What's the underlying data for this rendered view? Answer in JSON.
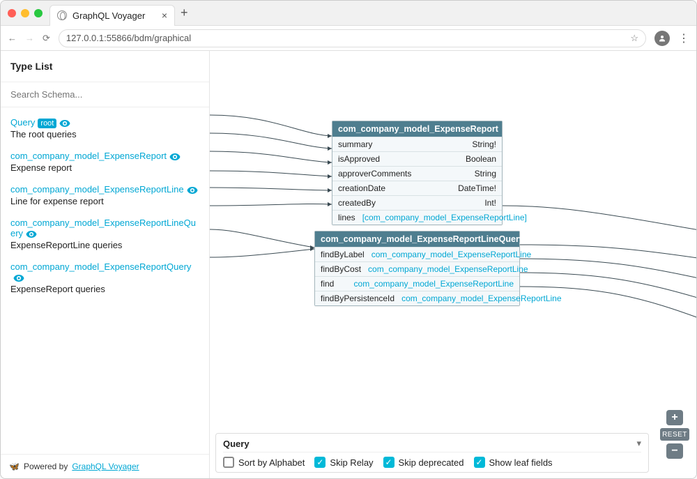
{
  "browser": {
    "tab_title": "GraphQL Voyager",
    "url": "127.0.0.1:55866/bdm/graphical"
  },
  "sidebar": {
    "title": "Type List",
    "search_placeholder": "Search Schema...",
    "items": [
      {
        "name": "Query",
        "root_badge": "root",
        "desc": "The root queries"
      },
      {
        "name": "com_company_model_ExpenseReport",
        "desc": "Expense report"
      },
      {
        "name": "com_company_model_ExpenseReportLine",
        "desc": "Line for expense report"
      },
      {
        "name": "com_company_model_ExpenseReportLineQuery",
        "desc": "ExpenseReportLine queries"
      },
      {
        "name": "com_company_model_ExpenseReportQuery",
        "desc": "ExpenseReport queries"
      }
    ],
    "footer_prefix": "Powered by ",
    "footer_link": "GraphQL Voyager"
  },
  "canvas": {
    "cards": [
      {
        "title": "com_company_model_ExpenseReport",
        "fields": [
          {
            "k": "summary",
            "v": "String!",
            "link": false
          },
          {
            "k": "isApproved",
            "v": "Boolean",
            "link": false
          },
          {
            "k": "approverComments",
            "v": "String",
            "link": false
          },
          {
            "k": "creationDate",
            "v": "DateTime!",
            "link": false
          },
          {
            "k": "createdBy",
            "v": "Int!",
            "link": false
          },
          {
            "k": "lines",
            "v": "[com_company_model_ExpenseReportLine]",
            "link": true
          }
        ]
      },
      {
        "title": "com_company_model_ExpenseReportLineQuery",
        "fields": [
          {
            "k": "findByLabel",
            "v": "com_company_model_ExpenseReportLine",
            "link": true
          },
          {
            "k": "findByCost",
            "v": "com_company_model_ExpenseReportLine",
            "link": true
          },
          {
            "k": "find",
            "v": "com_company_model_ExpenseReportLine",
            "link": true
          },
          {
            "k": "findByPersistenceId",
            "v": "com_company_model_ExpenseReportLine",
            "link": true
          }
        ]
      }
    ]
  },
  "controls": {
    "title": "Query",
    "options": [
      {
        "label": "Sort by Alphabet",
        "checked": false
      },
      {
        "label": "Skip Relay",
        "checked": true
      },
      {
        "label": "Skip deprecated",
        "checked": true
      },
      {
        "label": "Show leaf fields",
        "checked": true
      }
    ],
    "reset": "RESET"
  }
}
